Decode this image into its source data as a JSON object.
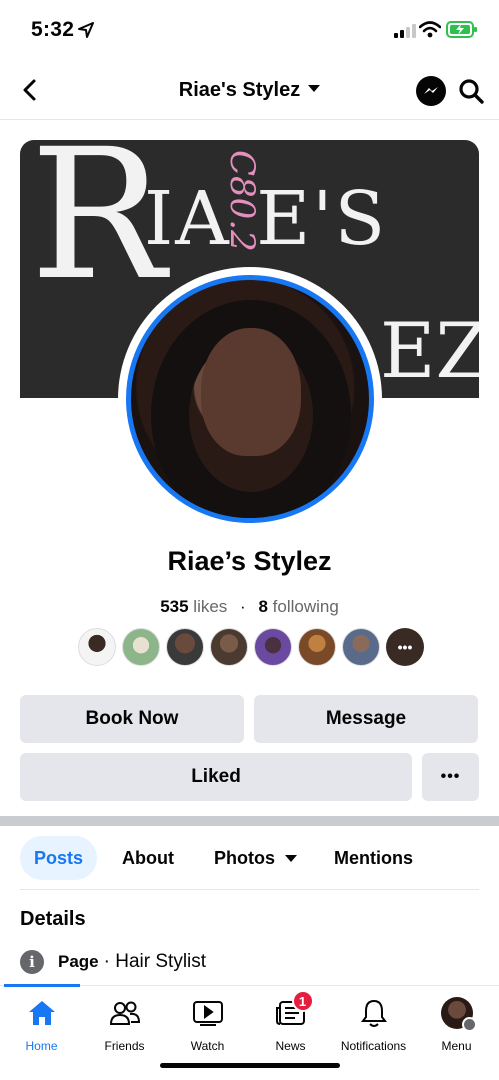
{
  "status": {
    "time": "5:32"
  },
  "nav": {
    "title": "Riae's Stylez",
    "icon_back": "back-chevron-icon",
    "icon_messenger": "messenger-icon",
    "icon_search": "search-icon"
  },
  "cover": {
    "line1": "IA E'S",
    "big_letter": "R",
    "line2": "EZ",
    "script": "C80.2"
  },
  "profile": {
    "name": "Riae’s Stylez",
    "likes_count": "535",
    "likes_label": "likes",
    "following_count": "8",
    "following_label": "following",
    "more_friends": "•••"
  },
  "actions": {
    "book": "Book Now",
    "message": "Message",
    "liked": "Liked",
    "more": "•••"
  },
  "tabs": {
    "posts": "Posts",
    "about": "About",
    "photos": "Photos",
    "mentions": "Mentions"
  },
  "details": {
    "heading": "Details",
    "info_icon": "i",
    "page_label": "Page",
    "page_value": "· Hair Stylist"
  },
  "bottom_nav": {
    "home": "Home",
    "friends": "Friends",
    "watch": "Watch",
    "news": "News",
    "news_badge": "1",
    "notifications": "Notifications",
    "menu": "Menu"
  },
  "colors": {
    "accent": "#1877f2",
    "badge": "#e41e3f",
    "button_bg": "#e4e6eb"
  }
}
